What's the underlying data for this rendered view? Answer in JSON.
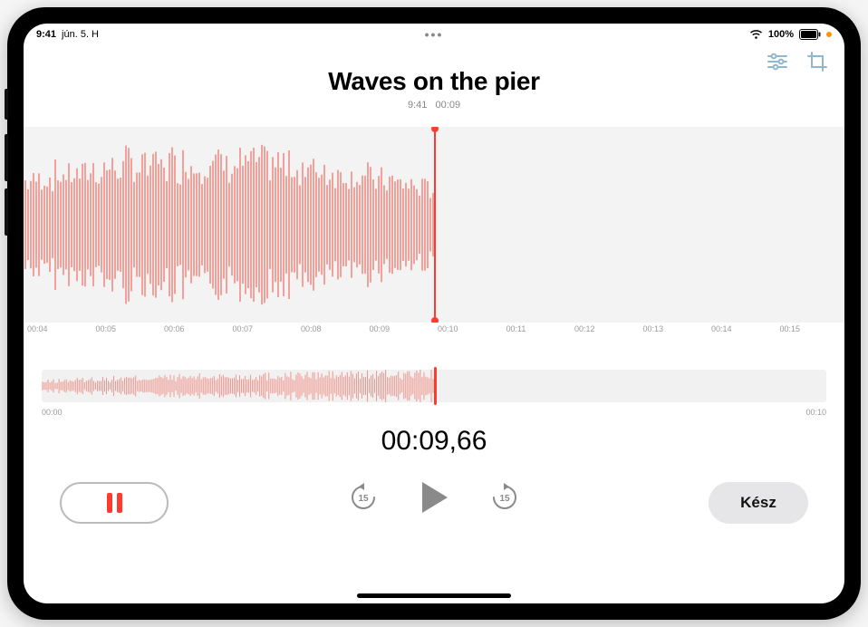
{
  "statusbar": {
    "time": "9:41",
    "date": "jún. 5. H",
    "battery_percent": "100%"
  },
  "header": {
    "title": "Waves on the pier",
    "subtitle_time": "9:41",
    "subtitle_duration": "00:09"
  },
  "ruler": {
    "ticks": [
      "00:04",
      "00:05",
      "00:06",
      "00:07",
      "00:08",
      "00:09",
      "00:10",
      "00:11",
      "00:12",
      "00:13",
      "00:14",
      "00:15"
    ]
  },
  "overview": {
    "start_label": "00:00",
    "end_label": "00:10"
  },
  "timer": {
    "display": "00:09,66"
  },
  "controls": {
    "done_label": "Kész",
    "skip_seconds": "15"
  },
  "colors": {
    "accent_red": "#ff3b30",
    "tool_tint": "#6aa7c9",
    "muted_gray": "#8a8a8a"
  },
  "playback": {
    "progress_fraction": 0.5
  }
}
